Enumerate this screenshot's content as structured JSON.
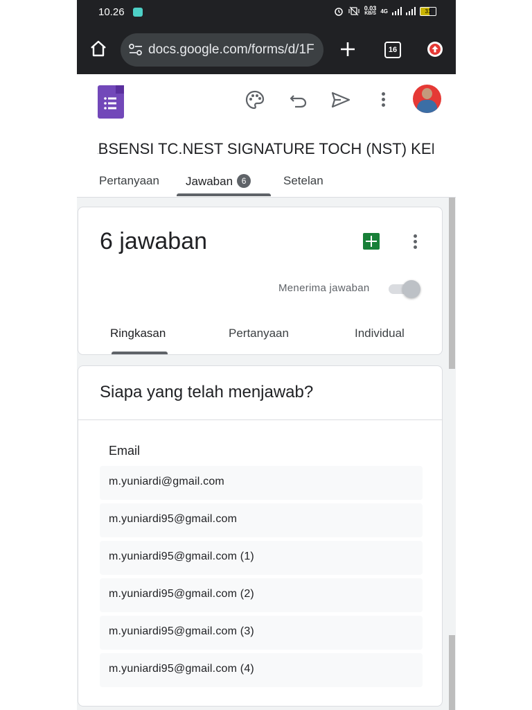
{
  "status_bar": {
    "time": "10.26",
    "net_speed": "0.03",
    "net_unit": "KB/S",
    "network": "4G",
    "battery": "31"
  },
  "browser": {
    "url": "docs.google.com/forms/d/1F",
    "tab_count": "16"
  },
  "form": {
    "title": "ABSENSI TC.NEST SIGNATURE TOCH (NST) KELOMPOK",
    "tabs": [
      {
        "label": "Pertanyaan"
      },
      {
        "label": "Jawaban",
        "badge": "6"
      },
      {
        "label": "Setelan"
      }
    ]
  },
  "responses": {
    "count_label": "6 jawaban",
    "accepting_label": "Menerima jawaban",
    "subtabs": [
      {
        "label": "Ringkasan"
      },
      {
        "label": "Pertanyaan"
      },
      {
        "label": "Individual"
      }
    ]
  },
  "respondents": {
    "title": "Siapa yang telah menjawab?",
    "column_header": "Email",
    "emails": [
      "m.yuniardi@gmail.com",
      "m.yuniardi95@gmail.com",
      "m.yuniardi95@gmail.com (1)",
      "m.yuniardi95@gmail.com (2)",
      "m.yuniardi95@gmail.com (3)",
      "m.yuniardi95@gmail.com (4)"
    ]
  },
  "colors": {
    "forms_purple": "#7248b9",
    "sheets_green": "#188038",
    "browser_dark": "#202124"
  },
  "icons": [
    "home-icon",
    "tune-icon",
    "plus-icon",
    "tab-switcher-icon",
    "update-icon",
    "forms-logo-icon",
    "palette-icon",
    "undo-icon",
    "send-icon",
    "more-vert-icon",
    "sheets-icon"
  ]
}
